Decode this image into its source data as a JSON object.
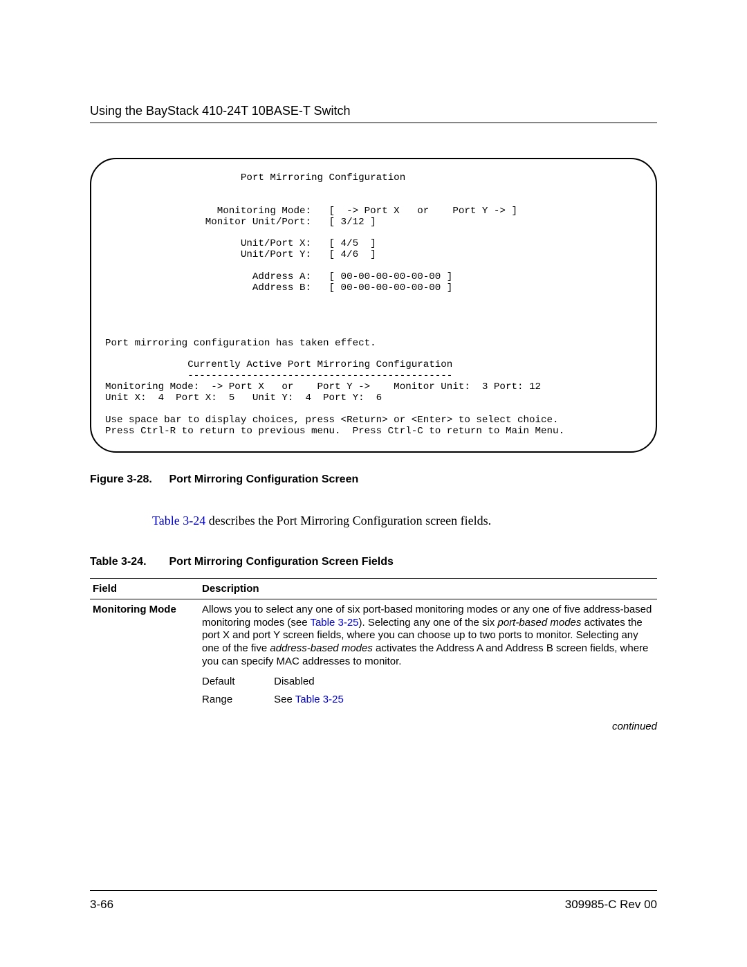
{
  "header": {
    "title": "Using the BayStack 410-24T 10BASE-T Switch"
  },
  "terminal": {
    "text": "                       Port Mirroring Configuration\n\n\n                   Monitoring Mode:   [  -> Port X   or    Port Y -> ]\n                 Monitor Unit/Port:   [ 3/12 ]\n\n                       Unit/Port X:   [ 4/5  ]\n                       Unit/Port Y:   [ 4/6  ]\n\n                         Address A:   [ 00-00-00-00-00-00 ]\n                         Address B:   [ 00-00-00-00-00-00 ]\n\n\n\n\nPort mirroring configuration has taken effect.\n\n              Currently Active Port Mirroring Configuration\n              ---------------------------------------------\nMonitoring Mode:  -> Port X   or    Port Y ->    Monitor Unit:  3 Port: 12\nUnit X:  4  Port X:  5   Unit Y:  4  Port Y:  6\n\nUse space bar to display choices, press <Return> or <Enter> to select choice.\nPress Ctrl-R to return to previous menu.  Press Ctrl-C to return to Main Menu."
  },
  "figure": {
    "number": "Figure 3-28.",
    "title": "Port Mirroring Configuration Screen"
  },
  "paragraph": {
    "link": "Table 3-24",
    "rest": " describes the Port Mirroring Configuration screen fields."
  },
  "table_caption": {
    "number": "Table 3-24.",
    "title": "Port Mirroring Configuration Screen Fields"
  },
  "table": {
    "headers": {
      "field": "Field",
      "description": "Description"
    },
    "row": {
      "field": "Monitoring Mode",
      "desc_1": "Allows you to select any one of six port-based monitoring modes or any one of five address-based monitoring modes (see ",
      "desc_link1": "Table 3-25",
      "desc_2": "). Selecting any one of the six ",
      "desc_italic1": "port-based modes",
      "desc_3": " activates the port X and port Y screen fields, where you can choose up to two ports to monitor. Selecting any one of the five ",
      "desc_italic2": "address-based modes",
      "desc_4": " activates the Address A and Address B screen fields, where you can specify MAC addresses to monitor.",
      "default_label": "Default",
      "default_value": "Disabled",
      "range_label": "Range",
      "range_prefix": "See ",
      "range_link": "Table 3-25"
    }
  },
  "continued": "continued",
  "footer": {
    "page": "3-66",
    "doc": "309985-C Rev 00"
  }
}
